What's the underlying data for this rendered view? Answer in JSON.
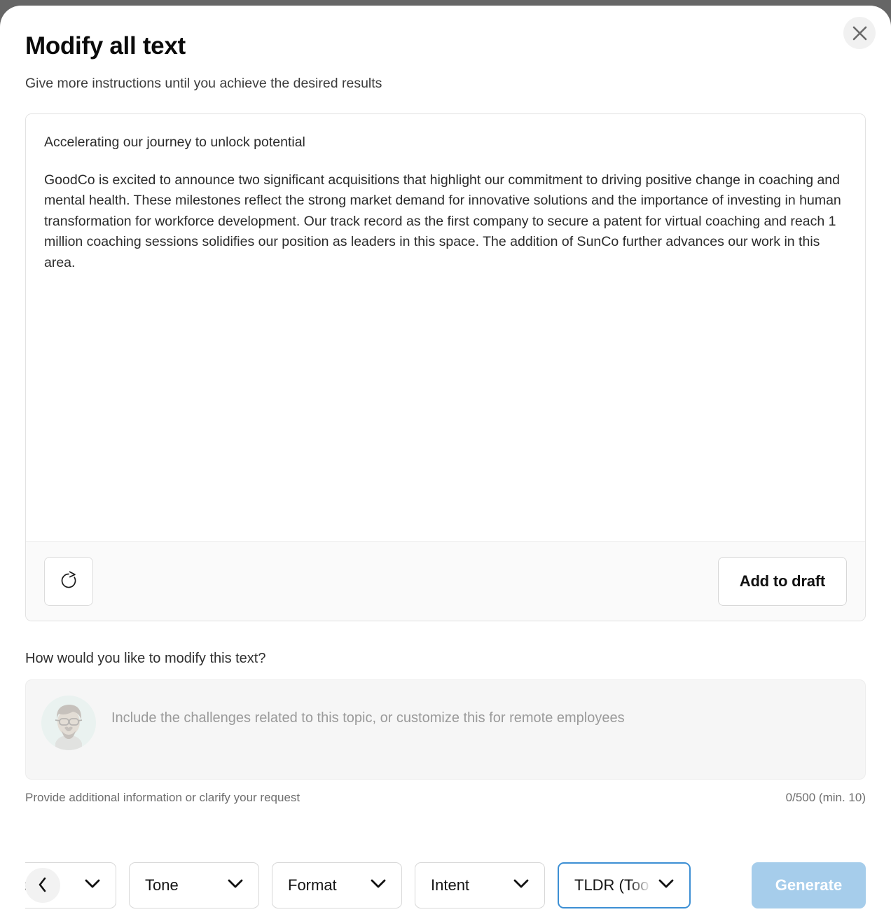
{
  "modal": {
    "title": "Modify all text",
    "subtitle": "Give more instructions until you achieve the desired results",
    "close_label": "close-icon"
  },
  "generated_text": {
    "heading": "Accelerating our journey to unlock potential",
    "paragraph": "GoodCo is excited to announce two significant acquisitions that highlight our commitment to driving positive change in coaching and mental health. These milestones reflect the strong market demand for innovative solutions and the importance of investing in human transformation for workforce development. Our track record as the first company to secure a patent for virtual coaching and reach 1 million coaching sessions solidifies our position as leaders in this space. The addition of SunCo further advances our work in this area."
  },
  "card_actions": {
    "refresh_label": "refresh-icon",
    "add_to_draft_label": "Add to draft"
  },
  "prompt": {
    "question": "How would you like to modify this text?",
    "placeholder": "Include the challenges related to this topic, or customize this for remote employees",
    "value": "",
    "helper_text": "Provide additional information or clarify your request",
    "counter": "0/500 (min. 10)"
  },
  "toolbar": {
    "scroll_left_label": "chevron-left-icon",
    "chips": [
      {
        "label": "alues",
        "full_label": "Values",
        "focused": false,
        "clipped": true
      },
      {
        "label": "Tone",
        "full_label": "Tone",
        "focused": false,
        "clipped": false
      },
      {
        "label": "Format",
        "full_label": "Format",
        "focused": false,
        "clipped": false
      },
      {
        "label": "Intent",
        "full_label": "Intent",
        "focused": false,
        "clipped": false
      },
      {
        "label": "TLDR (Too",
        "full_label": "TLDR (Too",
        "focused": true,
        "clipped": false
      }
    ],
    "generate_label": "Generate"
  },
  "colors": {
    "backdrop": "#666666",
    "accent_blue": "#a6cdeb",
    "focus_blue": "#3c8fd4",
    "surface": "#ffffff",
    "muted_surface": "#f6f6f6"
  }
}
